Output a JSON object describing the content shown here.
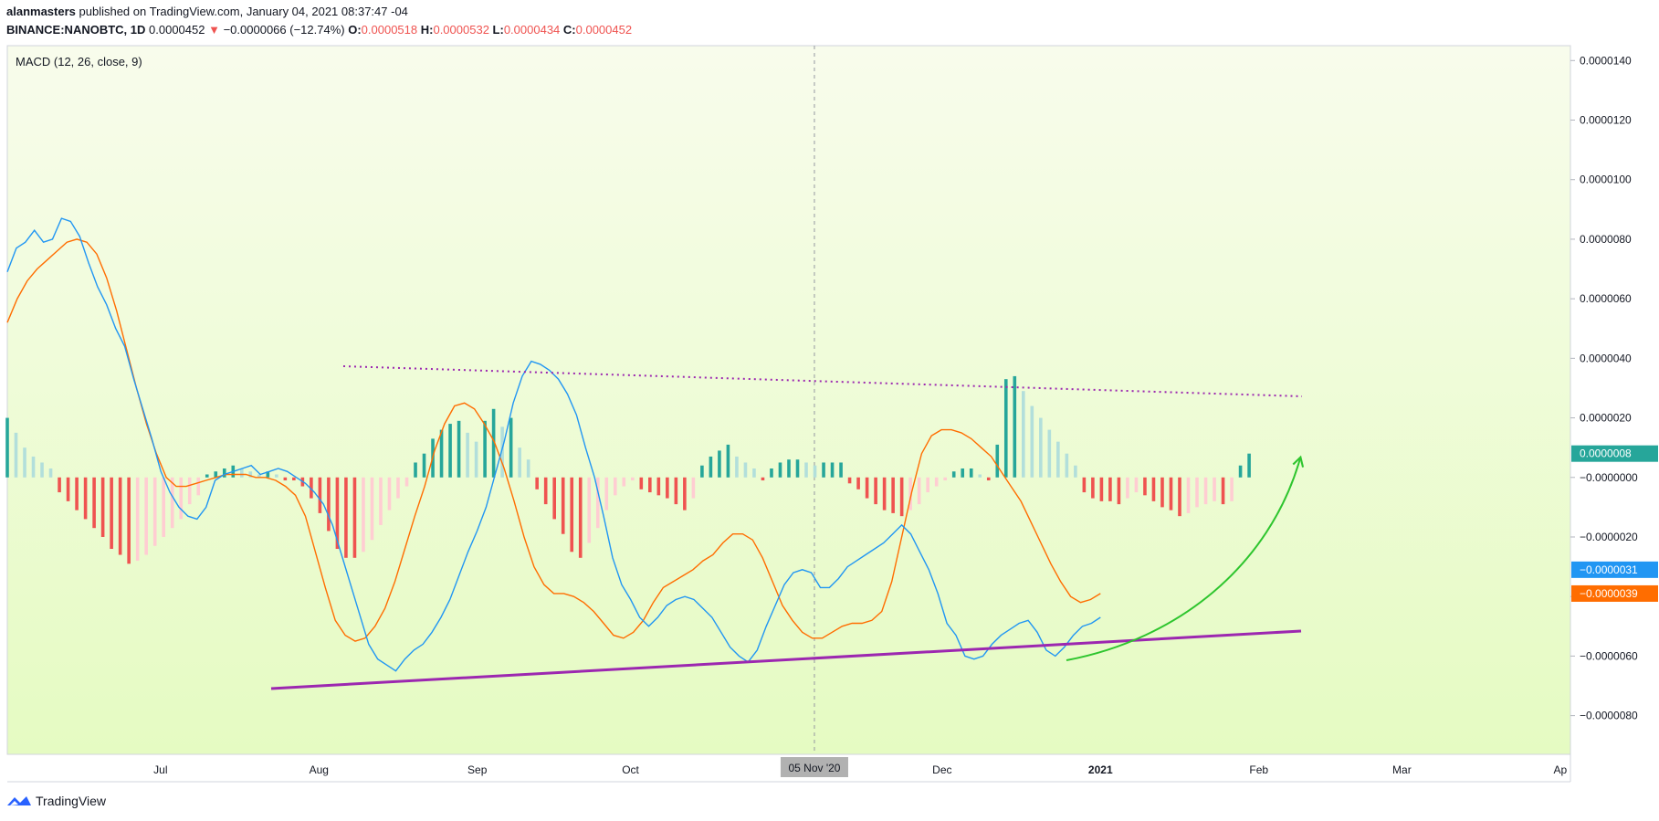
{
  "header": {
    "author": "alanmasters",
    "published_text": " published on TradingView.com, January 04, 2021 08:37:47 -04",
    "symbol": "BINANCE:NANOBTC, 1D",
    "last": "0.0000452",
    "arrow": "▼",
    "change": "−0.0000066 (−12.74%)",
    "o_label": "O:",
    "o_value": "0.0000518",
    "h_label": "H:",
    "h_value": "0.0000532",
    "l_label": "L:",
    "l_value": "0.0000434",
    "c_label": "C:",
    "c_value": "0.0000452"
  },
  "brand": {
    "name": "TradingView"
  },
  "chart_data": {
    "type": "line",
    "title": "MACD (12, 26, close, 9)",
    "ylim": [
      -9.3e-06,
      1.45e-05
    ],
    "y_ticks": [
      {
        "v": 1.4e-05,
        "label": "0.0000140"
      },
      {
        "v": 1.2e-05,
        "label": "0.0000120"
      },
      {
        "v": 1e-05,
        "label": "0.0000100"
      },
      {
        "v": 8e-06,
        "label": "0.0000080"
      },
      {
        "v": 6e-06,
        "label": "0.0000060"
      },
      {
        "v": 4e-06,
        "label": "0.0000040"
      },
      {
        "v": 2e-06,
        "label": "0.0000020"
      },
      {
        "v": 0.0,
        "label": "−0.0000000"
      },
      {
        "v": -2e-06,
        "label": "−0.0000020"
      },
      {
        "v": -4e-06,
        "label": "−0.0000040"
      },
      {
        "v": -6e-06,
        "label": "−0.0000060"
      },
      {
        "v": -8e-06,
        "label": "−0.0000080"
      }
    ],
    "x_ticks": [
      {
        "day": 30,
        "label": "Jul",
        "bold": false
      },
      {
        "day": 61,
        "label": "Aug",
        "bold": false
      },
      {
        "day": 92,
        "label": "Sep",
        "bold": false
      },
      {
        "day": 122,
        "label": "Oct",
        "bold": false
      },
      {
        "day": 183,
        "label": "Dec",
        "bold": false
      },
      {
        "day": 214,
        "label": "2021",
        "bold": true
      },
      {
        "day": 245,
        "label": "Feb",
        "bold": false
      },
      {
        "day": 273,
        "label": "Mar",
        "bold": false
      },
      {
        "day": 304,
        "label": "Ap",
        "bold": false
      }
    ],
    "crosshair": {
      "day": 158,
      "label": "05 Nov '20"
    },
    "last_values": [
      {
        "name": "Histogram",
        "label": "0.0000008",
        "v": 8e-07,
        "color": "#26a69a"
      },
      {
        "name": "MACD",
        "label": "−0.0000031",
        "v": -3.1e-06,
        "color": "#2196f3"
      },
      {
        "name": "Signal",
        "label": "−0.0000039",
        "v": -3.9e-06,
        "color": "#ff6d00"
      }
    ],
    "x_start_date": "2020-06-01",
    "macd": [
      [
        0,
        6.9
      ],
      [
        1,
        7.7
      ],
      [
        2,
        7.9
      ],
      [
        3,
        8.3
      ],
      [
        4,
        7.9
      ],
      [
        5,
        8.0
      ],
      [
        6,
        8.7
      ],
      [
        7,
        8.6
      ],
      [
        8,
        8.1
      ],
      [
        9,
        7.2
      ],
      [
        10,
        6.4
      ],
      [
        11,
        5.8
      ],
      [
        12,
        5.0
      ],
      [
        13,
        4.4
      ],
      [
        14,
        3.3
      ],
      [
        15,
        2.3
      ],
      [
        16,
        1.3
      ],
      [
        17,
        0.2
      ],
      [
        18,
        -0.5
      ],
      [
        19,
        -1.0
      ],
      [
        20,
        -1.3
      ],
      [
        21,
        -1.4
      ],
      [
        22,
        -1.0
      ],
      [
        23,
        -0.1
      ],
      [
        24,
        0.1
      ],
      [
        25,
        0.2
      ],
      [
        26,
        0.3
      ],
      [
        27,
        0.4
      ],
      [
        28,
        0.1
      ],
      [
        29,
        0.2
      ],
      [
        30,
        0.3
      ],
      [
        31,
        0.2
      ],
      [
        32,
        0.0
      ],
      [
        33,
        -0.2
      ],
      [
        34,
        -0.5
      ],
      [
        35,
        -0.9
      ],
      [
        36,
        -1.6
      ],
      [
        37,
        -2.6
      ],
      [
        38,
        -3.6
      ],
      [
        39,
        -4.6
      ],
      [
        40,
        -5.6
      ],
      [
        41,
        -6.1
      ],
      [
        42,
        -6.3
      ],
      [
        43,
        -6.5
      ],
      [
        44,
        -6.1
      ],
      [
        45,
        -5.8
      ],
      [
        46,
        -5.6
      ],
      [
        47,
        -5.2
      ],
      [
        48,
        -4.7
      ],
      [
        49,
        -4.1
      ],
      [
        50,
        -3.3
      ],
      [
        51,
        -2.5
      ],
      [
        52,
        -1.8
      ],
      [
        53,
        -1.0
      ],
      [
        54,
        0.1
      ],
      [
        55,
        1.2
      ],
      [
        56,
        2.5
      ],
      [
        57,
        3.4
      ],
      [
        58,
        3.9
      ],
      [
        59,
        3.8
      ],
      [
        60,
        3.6
      ],
      [
        61,
        3.3
      ],
      [
        62,
        2.8
      ],
      [
        63,
        2.1
      ],
      [
        64,
        1.0
      ],
      [
        65,
        0.0
      ],
      [
        66,
        -1.3
      ],
      [
        67,
        -2.7
      ],
      [
        68,
        -3.6
      ],
      [
        69,
        -4.1
      ],
      [
        70,
        -4.7
      ],
      [
        71,
        -5.0
      ],
      [
        72,
        -4.7
      ],
      [
        73,
        -4.3
      ],
      [
        74,
        -4.1
      ],
      [
        75,
        -4.0
      ],
      [
        76,
        -4.1
      ],
      [
        77,
        -4.4
      ],
      [
        78,
        -4.7
      ],
      [
        79,
        -5.2
      ],
      [
        80,
        -5.7
      ],
      [
        81,
        -6.0
      ],
      [
        82,
        -6.2
      ],
      [
        83,
        -5.8
      ],
      [
        84,
        -5.0
      ],
      [
        85,
        -4.3
      ],
      [
        86,
        -3.6
      ],
      [
        87,
        -3.2
      ],
      [
        88,
        -3.1
      ],
      [
        89,
        -3.2
      ],
      [
        90,
        -3.7
      ],
      [
        91,
        -3.7
      ],
      [
        92,
        -3.4
      ],
      [
        93,
        -3.0
      ],
      [
        94,
        -2.8
      ],
      [
        95,
        -2.6
      ],
      [
        96,
        -2.4
      ],
      [
        97,
        -2.2
      ],
      [
        98,
        -1.9
      ],
      [
        99,
        -1.6
      ],
      [
        100,
        -1.9
      ],
      [
        101,
        -2.5
      ],
      [
        102,
        -3.1
      ],
      [
        103,
        -3.9
      ],
      [
        104,
        -4.9
      ],
      [
        105,
        -5.3
      ],
      [
        106,
        -6.0
      ],
      [
        107,
        -6.1
      ],
      [
        108,
        -6.0
      ],
      [
        109,
        -5.6
      ],
      [
        110,
        -5.3
      ],
      [
        111,
        -5.1
      ],
      [
        112,
        -4.9
      ],
      [
        113,
        -4.8
      ],
      [
        114,
        -5.2
      ],
      [
        115,
        -5.8
      ],
      [
        116,
        -6.0
      ],
      [
        117,
        -5.7
      ],
      [
        118,
        -5.3
      ],
      [
        119,
        -5.0
      ],
      [
        120,
        -4.9
      ],
      [
        121,
        -4.7
      ]
    ],
    "signal": [
      [
        0,
        5.2
      ],
      [
        1,
        6.0
      ],
      [
        2,
        6.6
      ],
      [
        3,
        7.0
      ],
      [
        4,
        7.3
      ],
      [
        5,
        7.6
      ],
      [
        6,
        7.9
      ],
      [
        7,
        8.0
      ],
      [
        8,
        7.9
      ],
      [
        9,
        7.5
      ],
      [
        10,
        6.7
      ],
      [
        11,
        5.6
      ],
      [
        12,
        4.3
      ],
      [
        13,
        3.0
      ],
      [
        14,
        1.8
      ],
      [
        15,
        0.8
      ],
      [
        16,
        0.0
      ],
      [
        17,
        -0.3
      ],
      [
        18,
        -0.3
      ],
      [
        19,
        -0.2
      ],
      [
        20,
        -0.1
      ],
      [
        21,
        0.0
      ],
      [
        22,
        0.1
      ],
      [
        23,
        0.1
      ],
      [
        24,
        0.1
      ],
      [
        25,
        0.0
      ],
      [
        26,
        0.0
      ],
      [
        27,
        -0.1
      ],
      [
        28,
        -0.3
      ],
      [
        29,
        -0.6
      ],
      [
        30,
        -1.3
      ],
      [
        31,
        -2.5
      ],
      [
        32,
        -3.7
      ],
      [
        33,
        -4.8
      ],
      [
        34,
        -5.3
      ],
      [
        35,
        -5.5
      ],
      [
        36,
        -5.4
      ],
      [
        37,
        -5.0
      ],
      [
        38,
        -4.4
      ],
      [
        39,
        -3.5
      ],
      [
        40,
        -2.4
      ],
      [
        41,
        -1.3
      ],
      [
        42,
        -0.3
      ],
      [
        43,
        0.9
      ],
      [
        44,
        1.8
      ],
      [
        45,
        2.4
      ],
      [
        46,
        2.5
      ],
      [
        47,
        2.3
      ],
      [
        48,
        1.8
      ],
      [
        49,
        1.2
      ],
      [
        50,
        0.3
      ],
      [
        51,
        -0.8
      ],
      [
        52,
        -2.0
      ],
      [
        53,
        -3.0
      ],
      [
        54,
        -3.6
      ],
      [
        55,
        -3.9
      ],
      [
        56,
        -3.9
      ],
      [
        57,
        -4.0
      ],
      [
        58,
        -4.2
      ],
      [
        59,
        -4.5
      ],
      [
        60,
        -4.9
      ],
      [
        61,
        -5.3
      ],
      [
        62,
        -5.4
      ],
      [
        63,
        -5.2
      ],
      [
        64,
        -4.8
      ],
      [
        65,
        -4.2
      ],
      [
        66,
        -3.7
      ],
      [
        67,
        -3.5
      ],
      [
        68,
        -3.3
      ],
      [
        69,
        -3.1
      ],
      [
        70,
        -2.8
      ],
      [
        71,
        -2.6
      ],
      [
        72,
        -2.2
      ],
      [
        73,
        -1.9
      ],
      [
        74,
        -1.9
      ],
      [
        75,
        -2.1
      ],
      [
        76,
        -2.7
      ],
      [
        77,
        -3.5
      ],
      [
        78,
        -4.3
      ],
      [
        79,
        -4.8
      ],
      [
        80,
        -5.2
      ],
      [
        81,
        -5.4
      ],
      [
        82,
        -5.4
      ],
      [
        83,
        -5.2
      ],
      [
        84,
        -5.0
      ],
      [
        85,
        -4.9
      ],
      [
        86,
        -4.9
      ],
      [
        87,
        -4.8
      ],
      [
        88,
        -4.5
      ],
      [
        89,
        -3.5
      ],
      [
        90,
        -2.0
      ],
      [
        91,
        -0.5
      ],
      [
        92,
        0.8
      ],
      [
        93,
        1.4
      ],
      [
        94,
        1.6
      ],
      [
        95,
        1.6
      ],
      [
        96,
        1.5
      ],
      [
        97,
        1.3
      ],
      [
        98,
        1.0
      ],
      [
        99,
        0.7
      ],
      [
        100,
        0.2
      ],
      [
        101,
        -0.3
      ],
      [
        102,
        -0.8
      ],
      [
        103,
        -1.5
      ],
      [
        104,
        -2.2
      ],
      [
        105,
        -2.9
      ],
      [
        106,
        -3.5
      ],
      [
        107,
        -4.0
      ],
      [
        108,
        -4.2
      ],
      [
        109,
        -4.1
      ],
      [
        110,
        -3.9
      ]
    ],
    "histogram": [
      [
        0,
        2.0
      ],
      [
        1,
        1.5
      ],
      [
        2,
        1.0
      ],
      [
        3,
        0.7
      ],
      [
        4,
        0.5
      ],
      [
        5,
        0.3
      ],
      [
        6,
        -0.5
      ],
      [
        7,
        -0.8
      ],
      [
        8,
        -1.1
      ],
      [
        9,
        -1.4
      ],
      [
        10,
        -1.7
      ],
      [
        11,
        -2.0
      ],
      [
        12,
        -2.4
      ],
      [
        13,
        -2.6
      ],
      [
        14,
        -2.9
      ],
      [
        15,
        -2.8
      ],
      [
        16,
        -2.6
      ],
      [
        17,
        -2.3
      ],
      [
        18,
        -2.0
      ],
      [
        19,
        -1.7
      ],
      [
        20,
        -1.4
      ],
      [
        21,
        -0.9
      ],
      [
        22,
        -0.6
      ],
      [
        23,
        0.1
      ],
      [
        24,
        0.2
      ],
      [
        25,
        0.3
      ],
      [
        26,
        0.4
      ],
      [
        27,
        0.3
      ],
      [
        28,
        0.2
      ],
      [
        29,
        0.1
      ],
      [
        30,
        0.2
      ],
      [
        31,
        0.1
      ],
      [
        32,
        -0.1
      ],
      [
        33,
        -0.1
      ],
      [
        34,
        -0.3
      ],
      [
        35,
        -0.7
      ],
      [
        36,
        -1.2
      ],
      [
        37,
        -1.8
      ],
      [
        38,
        -2.4
      ],
      [
        39,
        -2.7
      ],
      [
        40,
        -2.7
      ],
      [
        41,
        -2.5
      ],
      [
        42,
        -2.1
      ],
      [
        43,
        -1.6
      ],
      [
        44,
        -1.1
      ],
      [
        45,
        -0.7
      ],
      [
        46,
        -0.3
      ],
      [
        47,
        0.5
      ],
      [
        48,
        0.8
      ],
      [
        49,
        1.3
      ],
      [
        50,
        1.6
      ],
      [
        51,
        1.8
      ],
      [
        52,
        1.9
      ],
      [
        53,
        1.5
      ],
      [
        54,
        1.2
      ],
      [
        55,
        1.9
      ],
      [
        56,
        2.3
      ],
      [
        57,
        1.7
      ],
      [
        58,
        2.0
      ],
      [
        59,
        1.0
      ],
      [
        60,
        0.6
      ],
      [
        61,
        -0.4
      ],
      [
        62,
        -0.9
      ],
      [
        63,
        -1.4
      ],
      [
        64,
        -1.9
      ],
      [
        65,
        -2.5
      ],
      [
        66,
        -2.7
      ],
      [
        67,
        -2.2
      ],
      [
        68,
        -1.7
      ],
      [
        69,
        -1.1
      ],
      [
        70,
        -0.6
      ],
      [
        71,
        -0.3
      ],
      [
        72,
        -0.1
      ],
      [
        73,
        -0.4
      ],
      [
        74,
        -0.5
      ],
      [
        75,
        -0.6
      ],
      [
        76,
        -0.7
      ],
      [
        77,
        -0.9
      ],
      [
        78,
        -1.1
      ],
      [
        79,
        -0.7
      ],
      [
        80,
        0.4
      ],
      [
        81,
        0.7
      ],
      [
        82,
        0.9
      ],
      [
        83,
        1.1
      ],
      [
        84,
        0.7
      ],
      [
        85,
        0.5
      ],
      [
        86,
        0.3
      ],
      [
        87,
        -0.1
      ],
      [
        88,
        0.3
      ],
      [
        89,
        0.5
      ],
      [
        90,
        0.6
      ],
      [
        91,
        0.6
      ],
      [
        92,
        0.5
      ],
      [
        93,
        0.4
      ],
      [
        94,
        0.5
      ],
      [
        95,
        0.5
      ],
      [
        96,
        0.5
      ],
      [
        97,
        -0.2
      ],
      [
        98,
        -0.4
      ],
      [
        99,
        -0.7
      ],
      [
        100,
        -0.9
      ],
      [
        101,
        -1.1
      ],
      [
        102,
        -1.2
      ],
      [
        103,
        -1.3
      ],
      [
        104,
        -1.1
      ],
      [
        105,
        -0.9
      ],
      [
        106,
        -0.5
      ],
      [
        107,
        -0.3
      ],
      [
        108,
        -0.1
      ],
      [
        109,
        0.2
      ],
      [
        110,
        0.3
      ],
      [
        111,
        0.3
      ],
      [
        112,
        0.1
      ],
      [
        113,
        -0.1
      ],
      [
        114,
        1.1
      ],
      [
        115,
        3.3
      ],
      [
        116,
        3.4
      ],
      [
        117,
        2.9
      ],
      [
        118,
        2.4
      ],
      [
        119,
        2.0
      ],
      [
        120,
        1.6
      ],
      [
        121,
        1.2
      ],
      [
        122,
        0.8
      ],
      [
        123,
        0.4
      ],
      [
        124,
        -0.5
      ],
      [
        125,
        -0.7
      ],
      [
        126,
        -0.8
      ],
      [
        127,
        -0.8
      ],
      [
        128,
        -0.9
      ],
      [
        129,
        -0.7
      ],
      [
        130,
        -0.5
      ],
      [
        131,
        -0.6
      ],
      [
        132,
        -0.8
      ],
      [
        133,
        -1.0
      ],
      [
        134,
        -1.1
      ],
      [
        135,
        -1.3
      ],
      [
        136,
        -1.2
      ],
      [
        137,
        -1.0
      ],
      [
        138,
        -0.9
      ],
      [
        139,
        -0.8
      ],
      [
        140,
        -0.9
      ],
      [
        141,
        -0.8
      ],
      [
        142,
        0.4
      ],
      [
        143,
        0.8
      ]
    ],
    "value_scale": 1e-06
  }
}
